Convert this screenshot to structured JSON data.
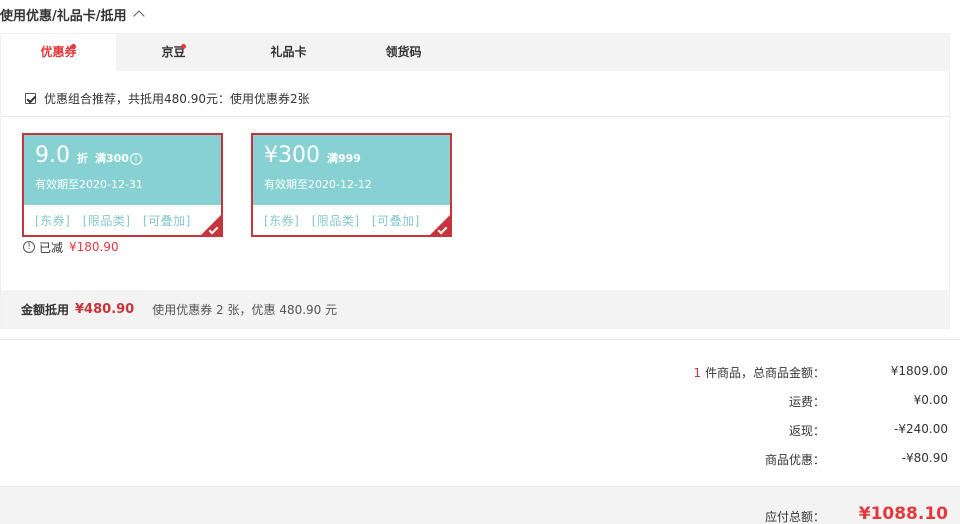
{
  "header": {
    "title": "使用优惠/礼品卡/抵用"
  },
  "tabs": [
    {
      "label": "优惠券",
      "active": true,
      "dot": true
    },
    {
      "label": "京豆",
      "active": false,
      "dot": true
    },
    {
      "label": "礼品卡",
      "active": false,
      "dot": false
    },
    {
      "label": "领货码",
      "active": false,
      "dot": false
    }
  ],
  "combo": {
    "checked": true,
    "text": "优惠组合推荐，共抵用480.90元：使用优惠券2张"
  },
  "coupons": [
    {
      "value": "9.0",
      "unit": "折",
      "condition": "满300",
      "expire": "有效期至2020-12-31",
      "tags": [
        "[东券]",
        "[限品类]",
        "[可叠加]"
      ],
      "selected": true
    },
    {
      "value": "¥300",
      "unit": "",
      "condition": "满999",
      "expire": "有效期至2020-12-12",
      "tags": [
        "[东券]",
        "[限品类]",
        "[可叠加]"
      ],
      "selected": true
    }
  ],
  "saved": {
    "label": "已减",
    "amount": "¥180.90"
  },
  "summary": {
    "label": "金额抵用",
    "amount": "¥480.90",
    "desc": "使用优惠券 2 张，优惠 480.90 元"
  },
  "totals": {
    "items_count": "1",
    "items_label": " 件商品，总商品金额：",
    "items_value": "¥1809.00",
    "shipping_label": "运费：",
    "shipping_value": "¥0.00",
    "cashback_label": "返现：",
    "cashback_value": "-¥240.00",
    "discount_label": "商品优惠：",
    "discount_value": "-¥80.90",
    "payable_label": "应付总额：",
    "payable_value": "¥1088.10"
  },
  "colors": {
    "accent": "#e4393c",
    "coupon_bg": "#87d1d3",
    "coupon_border": "#c8343b"
  }
}
